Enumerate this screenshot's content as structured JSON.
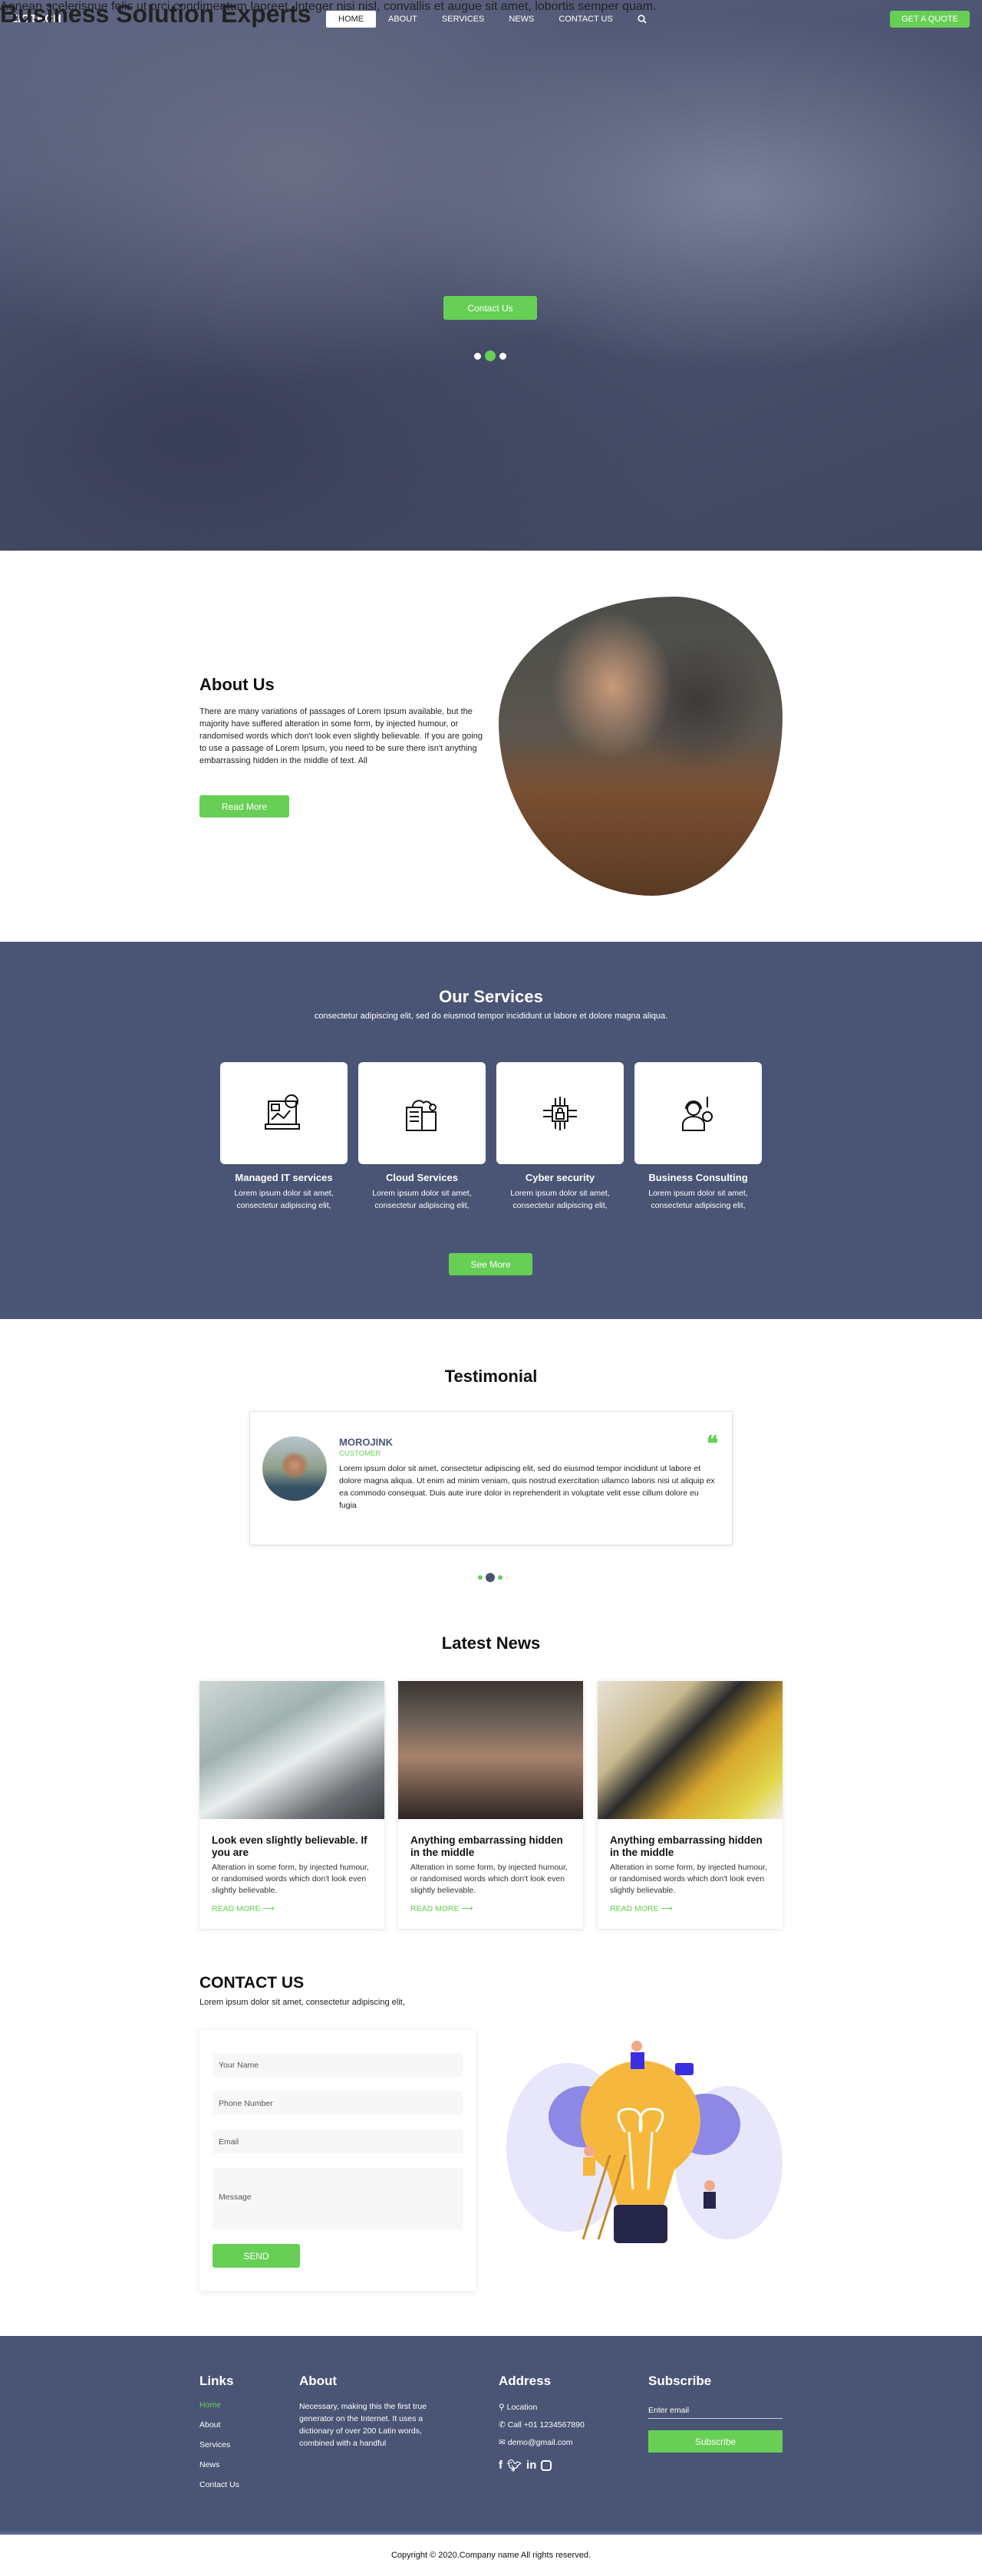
{
  "header": {
    "logo": "ZIOTECH",
    "nav": [
      "HOME",
      "ABOUT",
      "SERVICES",
      "NEWS",
      "CONTACT US"
    ],
    "active": "HOME",
    "quote_button": "GET A QUOTE"
  },
  "hero": {
    "title": "Business Solution Experts",
    "subtitle": "Aenean scelerisque felis ut orci condimentum laoreet. Integer nisi nisl, convallis et augue sit amet, lobortis semper quam.",
    "button": "Contact Us",
    "slides": 3,
    "active_slide": 2
  },
  "about": {
    "title": "About Us",
    "text": "There are many variations of passages of Lorem Ipsum available, but the majority have suffered alteration in some form, by injected humour, or randomised words which don't look even slightly believable. If you are going to use a passage of Lorem Ipsum, you need to be sure there isn't anything embarrassing hidden in the middle of text. All",
    "button": "Read More"
  },
  "services": {
    "title": "Our Services",
    "subtitle": "consectetur adipiscing elit, sed do eiusmod tempor incididunt ut labore et dolore magna aliqua.",
    "items": [
      {
        "title": "Managed IT services",
        "desc": "Lorem ipsum dolor sit amet, consectetur adipiscing elit,",
        "icon": "laptop-chart-icon"
      },
      {
        "title": "Cloud Services",
        "desc": "Lorem ipsum dolor sit amet, consectetur adipiscing elit,",
        "icon": "cloud-server-icon"
      },
      {
        "title": "Cyber security",
        "desc": "Lorem ipsum dolor sit amet, consectetur adipiscing elit,",
        "icon": "circuit-lock-icon"
      },
      {
        "title": "Business Consulting",
        "desc": "Lorem ipsum dolor sit amet, consectetur adipiscing elit,",
        "icon": "support-agent-icon"
      }
    ],
    "button": "See More"
  },
  "testimonial": {
    "title": "Testimonial",
    "name": "MOROJINK",
    "role": "CUSTOMER",
    "text": "Lorem ipsum dolor sit amet, consectetur adipiscing elit, sed do eiusmod tempor incididunt ut labore et dolore magna aliqua. Ut enim ad minim veniam, quis nostrud exercitation ullamco laboris nisi ut aliquip ex ea commodo consequat. Duis aute irure dolor in reprehenderit in voluptate velit esse cillum dolore eu fugia",
    "active_slide": 2
  },
  "news": {
    "title": "Latest News",
    "items": [
      {
        "title": "Look even slightly believable. If you are",
        "text": "Alteration in some form, by injected humour, or randomised words which don't look even slightly believable.",
        "link": "READ MORE ⟶"
      },
      {
        "title": "Anything embarrassing hidden in the middle",
        "text": "Alteration in some form, by injected humour, or randomised words which don't look even slightly believable.",
        "link": "READ MORE ⟶"
      },
      {
        "title": "Anything embarrassing hidden in the middle",
        "text": "Alteration in some form, by injected humour, or randomised words which don't look even slightly believable.",
        "link": "READ MORE ⟶"
      }
    ]
  },
  "contact": {
    "title": "CONTACT US",
    "subtitle": "Lorem ipsum dolor sit amet, consectetur adipiscing elit,",
    "name_placeholder": "Your Name",
    "phone_placeholder": "Phone Number",
    "email_placeholder": "Email",
    "message_placeholder": "Message",
    "send": "SEND"
  },
  "footer": {
    "links_title": "Links",
    "links": [
      "Home",
      "About",
      "Services",
      "News",
      "Contact Us"
    ],
    "about_title": "About",
    "about_text": "Necessary, making this the first true generator on the Internet. It uses a dictionary of over 200 Latin words, combined with a handful",
    "address_title": "Address",
    "location": "Location",
    "phone": "Call +01 1234567890",
    "email": "demo@gmail.com",
    "subscribe_title": "Subscribe",
    "email_placeholder": "Enter email",
    "subscribe_button": "Subscribe",
    "copyright": "Copyright © 2020.Company name All rights reserved."
  },
  "colors": {
    "accent": "#67cf55",
    "navy": "#4a5575"
  }
}
